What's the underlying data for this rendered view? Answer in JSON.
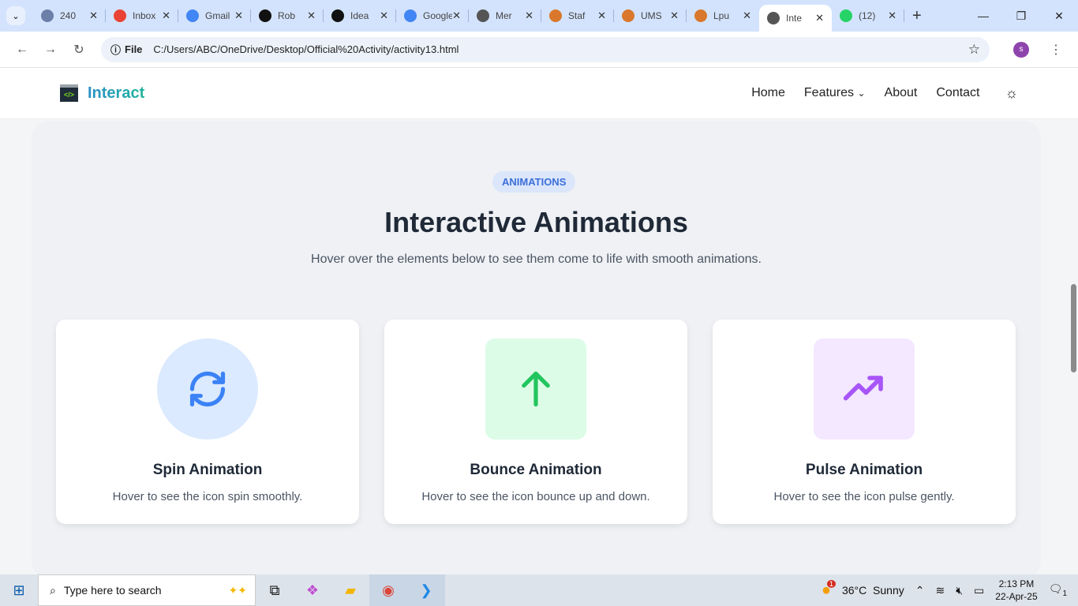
{
  "browser": {
    "tabs": [
      {
        "label": "240",
        "color": "#6b7fa8"
      },
      {
        "label": "Inbox",
        "color": "#ea4335"
      },
      {
        "label": "Gmail",
        "color": "#4285f4"
      },
      {
        "label": "Rob",
        "color": "#111"
      },
      {
        "label": "Idea",
        "color": "#111"
      },
      {
        "label": "Google",
        "color": "#4285f4"
      },
      {
        "label": "Mer",
        "color": "#555"
      },
      {
        "label": "Staf",
        "color": "#d9782d"
      },
      {
        "label": "UMS",
        "color": "#d9782d"
      },
      {
        "label": "Lpu",
        "color": "#d9782d"
      },
      {
        "label": "Inte",
        "color": "#555",
        "active": true
      },
      {
        "label": "(12)",
        "color": "#25d366"
      }
    ],
    "url_scheme": "File",
    "url": "C:/Users/ABC/OneDrive/Desktop/Official%20Activity/activity13.html",
    "profile": "s"
  },
  "nav": {
    "brand": "Interact",
    "logo_glyph": "</>",
    "links": [
      "Home",
      "Features",
      "About",
      "Contact"
    ]
  },
  "section": {
    "badge": "ANIMATIONS",
    "title": "Interactive Animations",
    "subtitle": "Hover over the elements below to see them come to life with smooth animations.",
    "cards": [
      {
        "title": "Spin Animation",
        "desc": "Hover to see the icon spin smoothly."
      },
      {
        "title": "Bounce Animation",
        "desc": "Hover to see the icon bounce up and down."
      },
      {
        "title": "Pulse Animation",
        "desc": "Hover to see the icon pulse gently."
      }
    ]
  },
  "taskbar": {
    "search_placeholder": "Type here to search",
    "weather": "36°C  Sunny",
    "weather_badge": "1",
    "time": "2:13 PM",
    "date": "22-Apr-25",
    "notif_count": "1"
  }
}
